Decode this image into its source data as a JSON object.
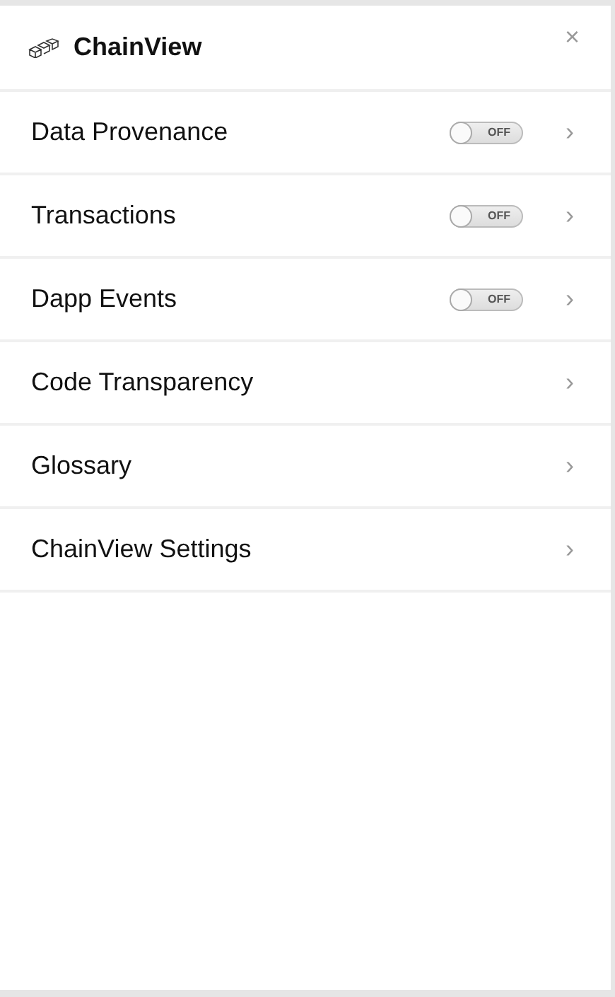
{
  "header": {
    "title": "ChainView",
    "close": "×"
  },
  "items": [
    {
      "label": "Data Provenance",
      "kind": "toggle",
      "on": false,
      "toggle_text": "OFF",
      "chevron": "›"
    },
    {
      "label": "Transactions",
      "kind": "toggle",
      "on": false,
      "toggle_text": "OFF",
      "chevron": "›"
    },
    {
      "label": "Dapp Events",
      "kind": "toggle",
      "on": false,
      "toggle_text": "OFF",
      "chevron": "›"
    },
    {
      "label": "Code Transparency",
      "kind": "link",
      "chevron": "›"
    },
    {
      "label": "Glossary",
      "kind": "link",
      "chevron": "›"
    },
    {
      "label": "ChainView Settings",
      "kind": "link",
      "chevron": "›"
    }
  ]
}
